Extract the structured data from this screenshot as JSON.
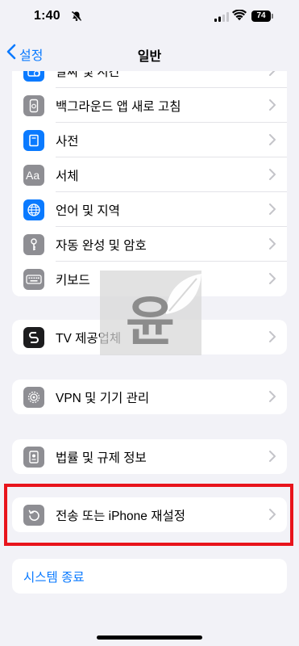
{
  "status": {
    "time": "1:40",
    "battery": "74"
  },
  "nav": {
    "back_label": "설정",
    "title": "일반"
  },
  "groups": {
    "first": [
      "날짜 및 시간",
      "백그라운드 앱 새로 고침",
      "사전",
      "서체",
      "언어 및 지역",
      "자동 완성 및 암호",
      "키보드"
    ],
    "tv": "TV 제공업체",
    "vpn": "VPN 및 기기 관리",
    "legal": "법률 및 규제 정보",
    "reset": "전송 또는 iPhone 재설정",
    "shutdown": "시스템 종료"
  },
  "icons": {
    "date": "calendar-clock-icon",
    "bgrefresh": "app-refresh-icon",
    "dictionary": "book-icon",
    "font": "font-aa-icon",
    "language": "globe-icon",
    "autofill": "key-icon",
    "keyboard": "keyboard-icon",
    "tv": "tv-provider-icon",
    "vpn": "gear-icon",
    "legal": "document-icon",
    "reset": "reset-arrow-icon"
  },
  "colors": {
    "accent": "#0a7aff",
    "highlight": "#e8141c",
    "background": "#f2f2f7"
  },
  "watermark": {
    "text": "윤"
  }
}
